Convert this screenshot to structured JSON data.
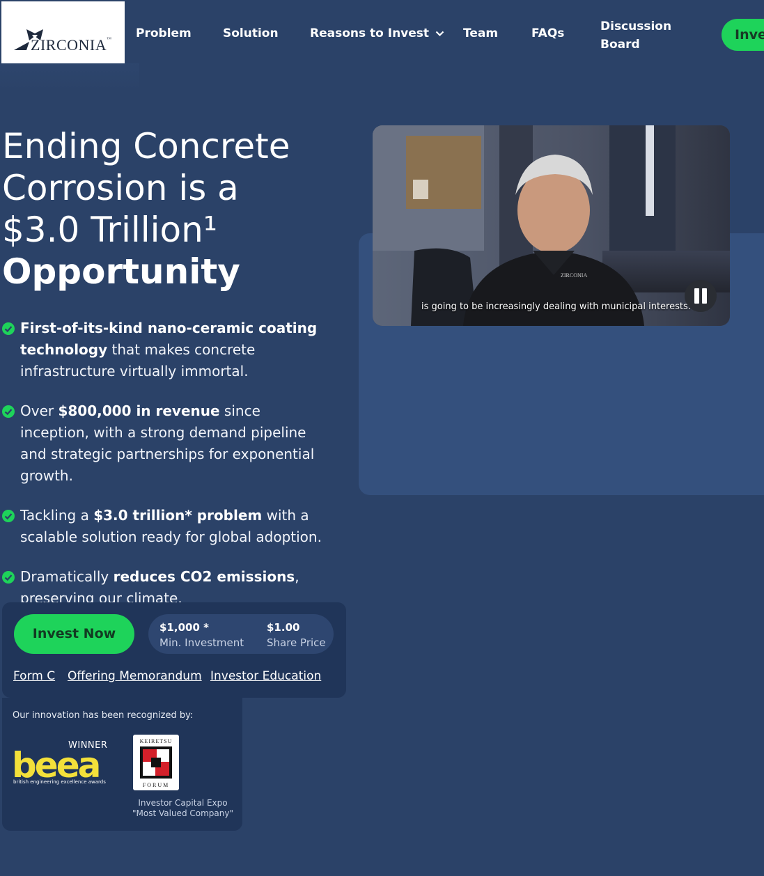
{
  "nav": {
    "brand": "ZIRCONIA",
    "items": [
      "Problem",
      "Solution",
      "Reasons to Invest",
      "Team",
      "FAQs"
    ],
    "discussion_line1": "Discussion",
    "discussion_line2": "Board",
    "cta": "Inve"
  },
  "hero": {
    "headline_line1": "Ending Concrete",
    "headline_line2": "Corrosion is a",
    "headline_line3": "$3.0 Trillion¹",
    "headline_bold": "Opportunity",
    "bullets": [
      {
        "pre": "",
        "bold": "First-of-its-kind nano-ceramic coating technology",
        "post": " that makes concrete infrastructure virtually immortal."
      },
      {
        "pre": "Over ",
        "bold": "$800,000 in revenue",
        "post": " since inception, with a strong demand pipeline and strategic partnerships for exponential growth."
      },
      {
        "pre": "Tackling a ",
        "bold": "$3.0 trillion* problem",
        "post": " with a scalable solution ready for global adoption."
      },
      {
        "pre": "Dramatically ",
        "bold": "reduces CO2 emissions",
        "post": ", preserving our climate."
      }
    ]
  },
  "video": {
    "caption": "is going to be increasingly dealing with municipal interests.",
    "shirt_logo": "ZIRCONIA"
  },
  "invest": {
    "button": "Invest Now",
    "min_value": "$1,000 *",
    "min_label": "Min. Investment",
    "price_value": "$1.00",
    "price_label": "Share Price",
    "links": [
      "Form C",
      "Offering Memorandum",
      "Investor Education"
    ]
  },
  "awards": {
    "title": "Our innovation has been recognized by:",
    "beea_winner": "WINNER",
    "beea_logo": "beea",
    "beea_sub": "british engineering excellence awards",
    "kf_top": "KEIRETSU",
    "kf_bottom": "FORUM",
    "kf_caption_line1": "Investor Capital Expo",
    "kf_caption_line2": "\"Most Valued Company\""
  },
  "colors": {
    "background": "#2b4268",
    "accent": "#1ed35a",
    "card": "#203559",
    "beea_yellow": "#f3e03a"
  }
}
